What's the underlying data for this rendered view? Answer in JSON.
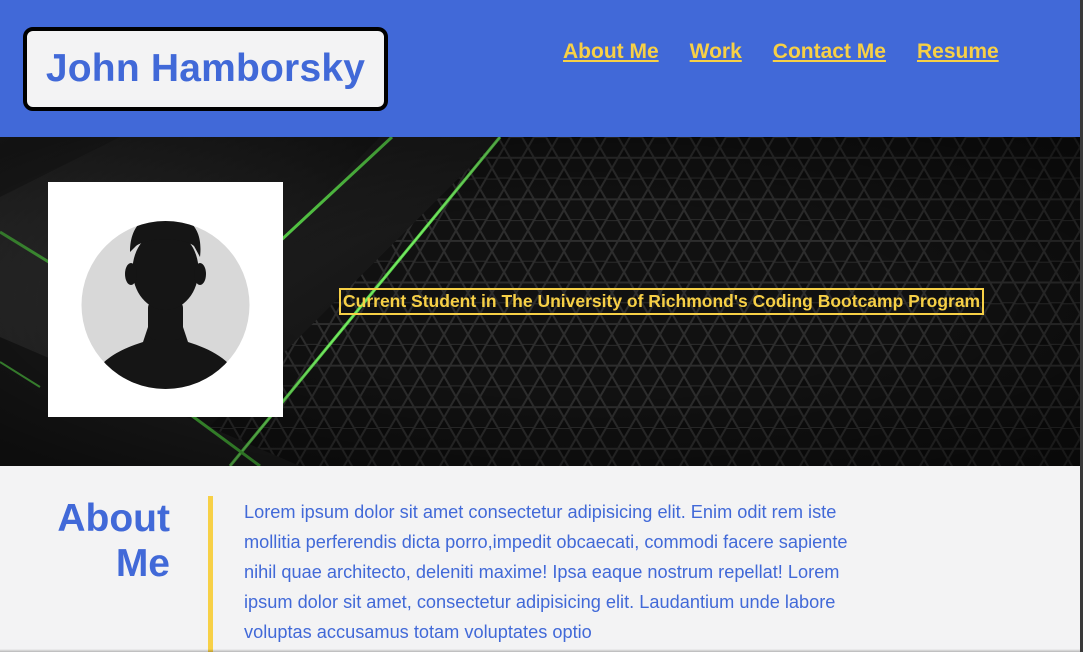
{
  "header": {
    "brand_name": "John Hamborsky",
    "nav": [
      {
        "label": "About Me"
      },
      {
        "label": "Work"
      },
      {
        "label": "Contact Me"
      },
      {
        "label": "Resume"
      }
    ]
  },
  "hero": {
    "tagline": "Current Student in The University of Richmond's Coding Bootcamp Program",
    "avatar_icon": "default-user-silhouette-icon"
  },
  "about": {
    "title": "About Me",
    "body": "Lorem ipsum dolor sit amet consectetur adipisicing elit. Enim odit rem iste mollitia perferendis dicta porro,impedit obcaecati, commodi facere sapiente nihil quae architecto, deleniti maxime! Ipsa eaque nostrum repellat! Lorem ipsum dolor sit amet, consectetur adipisicing elit. Laudantium unde labore voluptas accusamus totam voluptates optio"
  },
  "colors": {
    "primary_blue": "#4169d8",
    "accent_yellow": "#f7d046",
    "background_light": "#f3f3f4",
    "hero_accent_green": "#5bd84a"
  }
}
